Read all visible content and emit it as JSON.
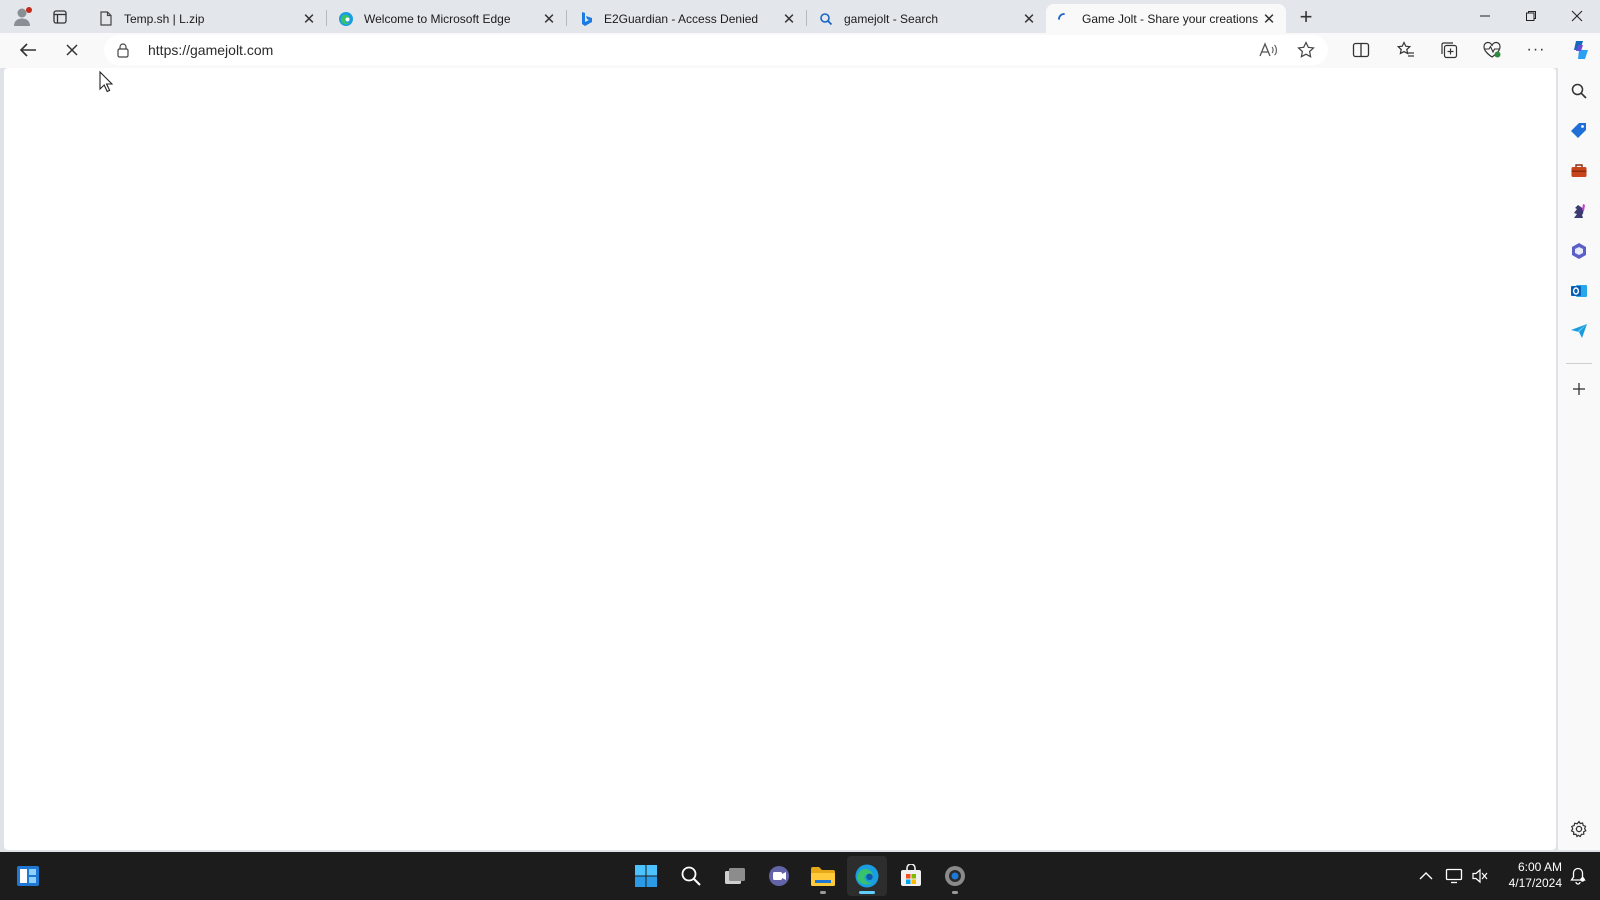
{
  "tabs": [
    {
      "title": "Temp.sh | L.zip",
      "favicon": "file-icon"
    },
    {
      "title": "Welcome to Microsoft Edge",
      "favicon": "edge-icon"
    },
    {
      "title": "E2Guardian - Access Denied",
      "favicon": "bing-icon"
    },
    {
      "title": "gamejolt - Search",
      "favicon": "search-icon"
    },
    {
      "title": "Game Jolt - Share your creations",
      "favicon": "loading-spinner-icon",
      "active": true
    }
  ],
  "address_bar": {
    "url": "https://gamejolt.com"
  },
  "taskbar": {
    "apps": [
      "start",
      "search",
      "task-view",
      "teams-chat",
      "file-explorer",
      "edge",
      "microsoft-store",
      "settings"
    ],
    "active_app": "edge"
  },
  "clock": {
    "time": "6:00 AM",
    "date": "4/17/2024"
  },
  "colors": {
    "accent": "#0078d4",
    "taskbar_bg": "#1c1c1c",
    "tabstrip_bg": "#e3e7ec"
  }
}
